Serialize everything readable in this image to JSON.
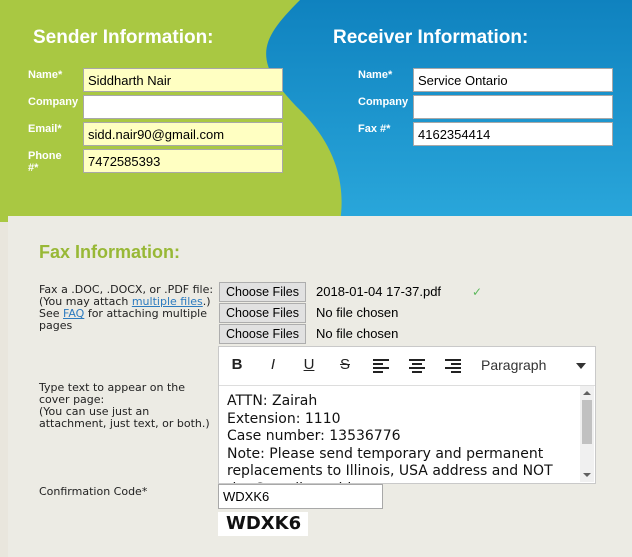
{
  "sender": {
    "heading": "Sender Information:",
    "fields": [
      {
        "label": "Name*",
        "value": "Siddharth Nair"
      },
      {
        "label": "Company",
        "value": ""
      },
      {
        "label": "Email*",
        "value": "sidd.nair90@gmail.com"
      },
      {
        "label": "Phone #*",
        "value": "7472585393"
      }
    ]
  },
  "receiver": {
    "heading": "Receiver Information:",
    "fields": [
      {
        "label": "Name*",
        "value": "Service Ontario"
      },
      {
        "label": "Company",
        "value": ""
      },
      {
        "label": "Fax #*",
        "value": "4162354414"
      }
    ]
  },
  "fax": {
    "heading": "Fax Information:",
    "attach_help": {
      "line1": "Fax a .DOC, .DOCX, or .PDF file:",
      "line2_pre": "(You may attach ",
      "line2_link": "multiple files",
      "line2_post": ".)",
      "line3_pre": "See ",
      "line3_link": "FAQ",
      "line3_post": " for attaching multiple pages"
    },
    "files": [
      {
        "button": "Choose Files",
        "name": "2018-01-04 17-37.pdf",
        "check": "✓"
      },
      {
        "button": "Choose Files",
        "name": "No file chosen"
      },
      {
        "button": "Choose Files",
        "name": "No file chosen"
      }
    ],
    "cover_help": "Type text to appear on the cover page:\n(You can use just an attachment, just text, or both.)",
    "toolbar": {
      "bold": "B",
      "italic": "I",
      "underline": "U",
      "strike": "S",
      "format": "Paragraph"
    },
    "cover_text": [
      "ATTN: Zairah",
      "Extension: 1110",
      "Case number: 13536776",
      "Note: Please send temporary and permanent replacements to Illinois, USA address and NOT the Canadian address."
    ],
    "confirmation_label": "Confirmation Code*",
    "confirmation_value": "WDXK6",
    "captcha": "WDXK6"
  },
  "colors": {
    "green": "#a8c940",
    "blue": "#1390c8",
    "accent": "#98b836"
  }
}
